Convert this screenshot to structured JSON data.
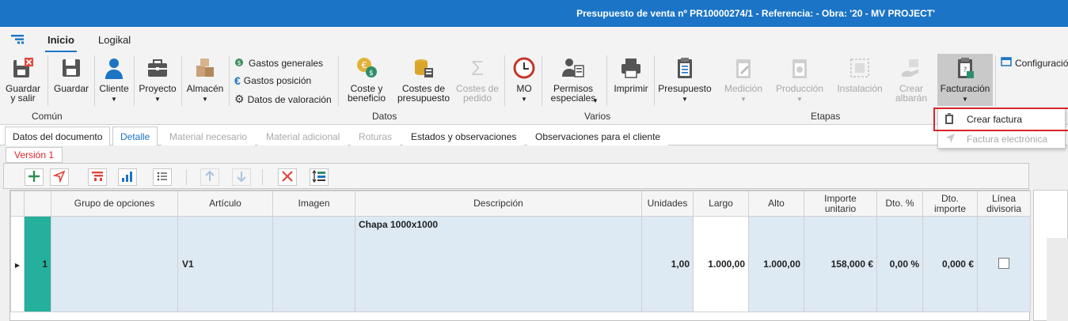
{
  "window": {
    "title": "Presupuesto de venta nº PR10000274/1 - Referencia:  - Obra: '20 - MV PROJECT'"
  },
  "ribbon_tabs": [
    "Inicio",
    "Logikal"
  ],
  "ribbon": {
    "guardar_salir": "Guardar\ny salir",
    "guardar": "Guardar",
    "cliente": "Cliente",
    "proyecto": "Proyecto",
    "almacen": "Almacén",
    "gastos_generales": "Gastos generales",
    "gastos_posicion": "Gastos posición",
    "datos_valoracion": "Datos de valoración",
    "coste_beneficio": "Coste y\nbeneficio",
    "costes_presupuesto": "Costes de\npresupuesto",
    "costes_pedido": "Costes de\npedido",
    "mo": "MO",
    "permisos_especiales": "Permisos\nespeciales",
    "imprimir": "Imprimir",
    "presupuesto": "Presupuesto",
    "medicion": "Medición",
    "produccion": "Producción",
    "instalacion": "Instalación",
    "crear_albaran": "Crear\nalbarán",
    "facturacion": "Facturación",
    "configuracion": "Configuració",
    "groups": {
      "comun": "Común",
      "datos": "Datos",
      "varios": "Varios",
      "etapas": "Etapas"
    }
  },
  "dropdown": {
    "crear_factura": "Crear factura",
    "factura_electronica": "Factura electrónica"
  },
  "doc_tabs": [
    "Datos del documento",
    "Detalle",
    "Material necesario",
    "Material adicional",
    "Roturas",
    "Estados y observaciones",
    "Observaciones para el cliente"
  ],
  "version_tab": "Versión 1",
  "grid": {
    "headers": [
      "",
      "",
      "Grupo de opciones",
      "Artículo",
      "Imagen",
      "Descripción",
      "Unidades",
      "Largo",
      "Alto",
      "Importe\nunitario",
      "Dto. %",
      "Dto.\nimporte",
      "Línea\ndivisoria"
    ],
    "rows": [
      {
        "num": "1",
        "grupo": "",
        "articulo": "V1",
        "imagen": "",
        "descripcion": "Chapa 1000x1000",
        "unidades": "1,00",
        "largo": "1.000,00",
        "alto": "1.000,00",
        "importe": "158,000 €",
        "dto_pct": "0,00 %",
        "dto_imp": "0,000 €",
        "linea_divisoria": false
      }
    ]
  },
  "colors": {
    "accent": "#1b74c5",
    "highlight": "#d9242b",
    "row_marker": "#24b09c",
    "row_bg": "#dde9f3"
  }
}
